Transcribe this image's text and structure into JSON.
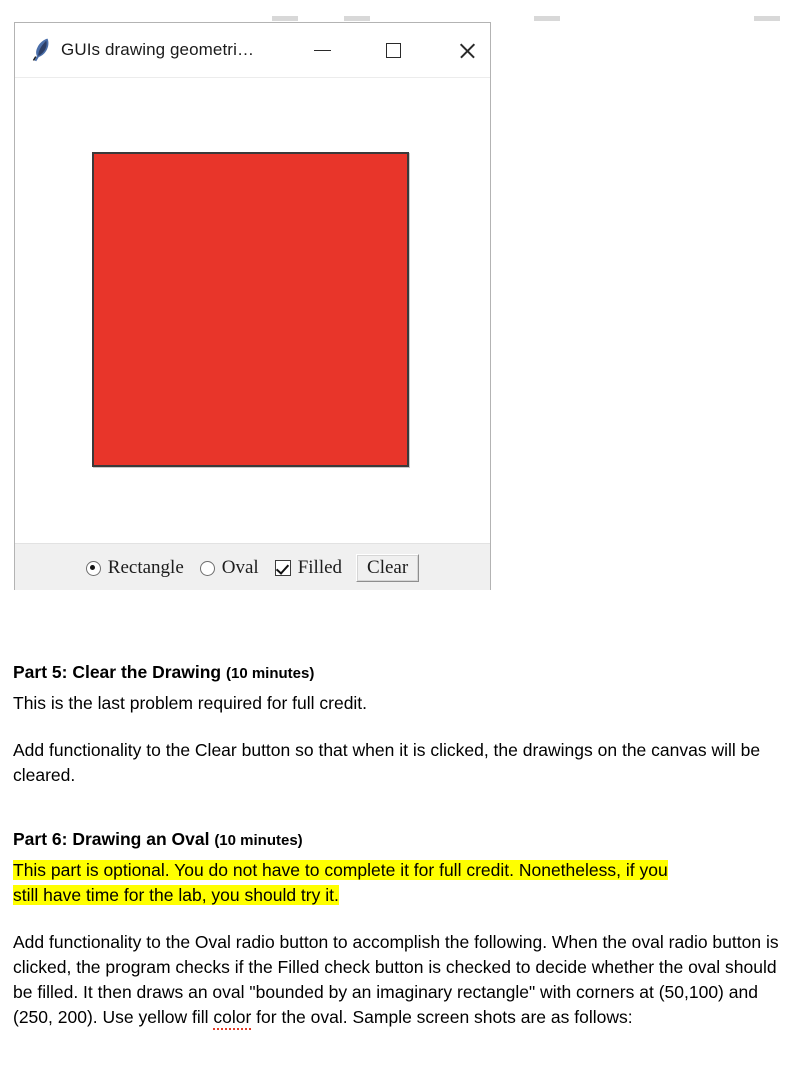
{
  "window": {
    "title": "GUIs drawing geometri…",
    "app_icon": "feather-icon",
    "controls": {
      "minimize": "—",
      "maximize": "□",
      "close": "×"
    }
  },
  "canvas": {
    "shape": "rectangle",
    "fill_color": "#e8352a",
    "outline_color": "#3a3a3a",
    "filled": true
  },
  "controls_bar": {
    "radio_rectangle": {
      "label": "Rectangle",
      "selected": true
    },
    "radio_oval": {
      "label": "Oval",
      "selected": false
    },
    "checkbox_filled": {
      "label": "Filled",
      "checked": true
    },
    "clear_button": {
      "label": "Clear"
    }
  },
  "document": {
    "part5": {
      "heading_main": "Part 5: Clear the Drawing ",
      "heading_minutes": "(10 minutes)",
      "line1": "This is the last problem required for full credit.",
      "para1": "Add functionality to the Clear button so that when it is clicked, the drawings on the canvas will be cleared."
    },
    "part6": {
      "heading_main": "Part 6: Drawing an Oval ",
      "heading_minutes": "(10 minutes)",
      "highlight_line1": "This part is optional. You do not have to complete it for full credit. Nonetheless, if you",
      "highlight_line2": "still have time for the lab, you should try it.",
      "para_a": "Add functionality to the Oval radio button to accomplish the following. When the oval radio button is clicked, the program checks if the Filled check button is checked to decide whether the oval should be filled. It then draws an oval \"bounded by an imaginary rectangle\" with corners at (50,100) and (250, 200). Use yellow fill ",
      "para_misspelled_word": "color",
      "para_b": " for the oval. Sample screen shots are as follows:"
    }
  },
  "colors": {
    "rect_fill": "#e8352a",
    "highlight": "#ffff00",
    "spellcheck_underline": "#e23b28",
    "panel_bg": "#f0f0f0"
  }
}
